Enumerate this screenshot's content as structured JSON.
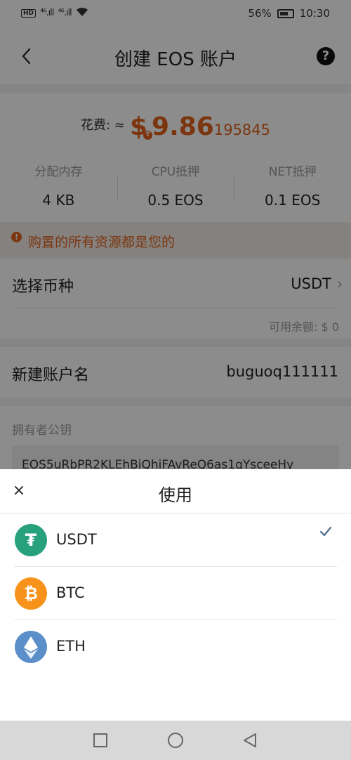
{
  "status_bar": {
    "hd": "HD",
    "signal_1": "⁴⁶.ıll",
    "signal_2": "⁴⁶.ıll",
    "battery_percent": "56%",
    "time": "10:30"
  },
  "nav": {
    "title": "创建 EOS 账户",
    "help_label": "?"
  },
  "cost": {
    "label": "花费: ≈",
    "currency_badge": "T",
    "amount_main": "9.86",
    "amount_sub": "195845"
  },
  "resources": [
    {
      "label": "分配内存",
      "value": "4 KB"
    },
    {
      "label": "CPU抵押",
      "value": "0.5 EOS"
    },
    {
      "label": "NET抵押",
      "value": "0.1 EOS"
    }
  ],
  "warning": {
    "icon": "!",
    "text": "购置的所有资源都是您的"
  },
  "currency_select": {
    "label": "选择币种",
    "value": "USDT",
    "available_label": "可用余额:",
    "available_value": "0"
  },
  "account": {
    "label": "新建账户名",
    "value": "buguoq111111"
  },
  "owner_key": {
    "label": "拥有者公钥",
    "value": "EOS5uRbPR2KLEhBiQhiFAvReQ6as1qYsceeHy"
  },
  "sheet": {
    "title": "使用",
    "close_label": "×",
    "coins": [
      {
        "name": "USDT",
        "symbol": "₮",
        "color": "#26a17b",
        "selected": true
      },
      {
        "name": "BTC",
        "symbol": "₿",
        "color": "#f7931a",
        "selected": false
      },
      {
        "name": "ETH",
        "symbol": "◆",
        "color": "#5a8fc9",
        "selected": false
      }
    ]
  },
  "colors": {
    "accent": "#e0631c",
    "check": "#4a6b8a"
  }
}
